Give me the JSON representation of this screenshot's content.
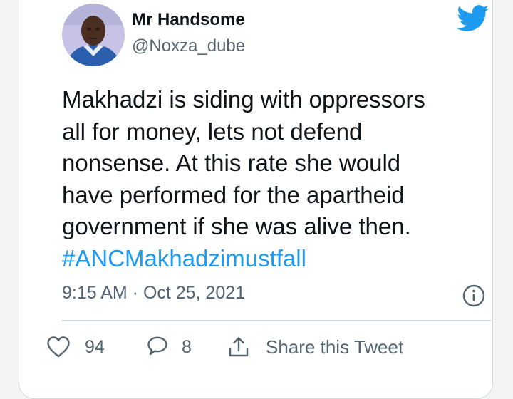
{
  "tweet": {
    "author": {
      "display_name": "Mr Handsome",
      "handle": "@Noxza_dube"
    },
    "text_lines": [
      "Makhadzi is siding with oppressors",
      "all for money, lets not defend",
      "nonsense. At this rate she would",
      "have performed for the apartheid",
      "government if she was alive then."
    ],
    "hashtag": "#ANCMakhadzimustfall",
    "timestamp": "9:15 AM · Oct 25, 2021",
    "likes": "94",
    "replies": "8",
    "share_label": "Share this Tweet"
  },
  "colors": {
    "accent": "#1d9bf0",
    "text": "#0f1419",
    "muted": "#536471",
    "border": "#cfd9de"
  },
  "icons": [
    "twitter-bird-icon",
    "info-icon",
    "heart-icon",
    "reply-bubble-icon",
    "share-icon"
  ]
}
